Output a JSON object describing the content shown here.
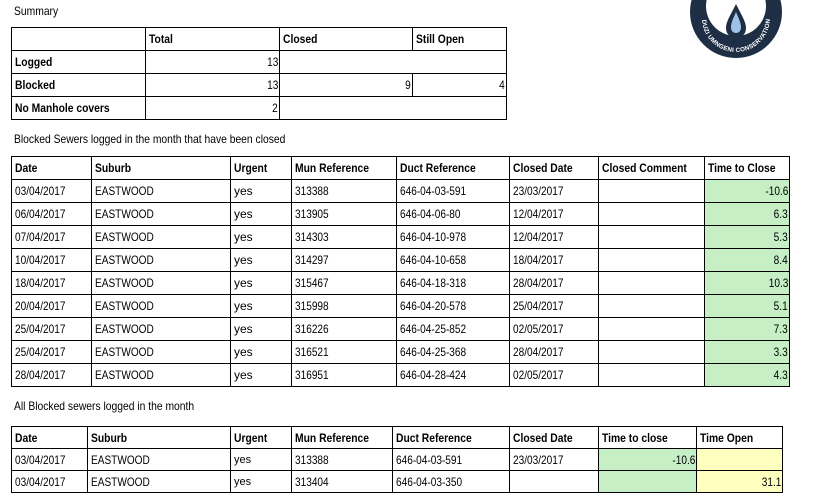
{
  "summary": {
    "title": "Summary",
    "headers": [
      "",
      "Total",
      "Closed",
      "Still Open"
    ],
    "rows": [
      {
        "label": "Logged",
        "total": "13",
        "closed": "",
        "open": ""
      },
      {
        "label": "Blocked",
        "total": "13",
        "closed": "9",
        "open": "4"
      },
      {
        "label": "No Manhole covers",
        "total": "2",
        "closed": "",
        "open": ""
      }
    ]
  },
  "closed_section": {
    "title": "Blocked Sewers logged in the month that have been closed",
    "headers": [
      "Date",
      "Suburb",
      "Urgent",
      "Mun Reference",
      "Duct Reference",
      "Closed Date",
      "Closed Comment",
      "Time to Close"
    ],
    "rows": [
      {
        "date": "03/04/2017",
        "suburb": "EASTWOOD",
        "urgent": "yes",
        "mun": "313388",
        "duct": "646-04-03-591",
        "closed_date": "23/03/2017",
        "comment": "",
        "time": "-10.6"
      },
      {
        "date": "06/04/2017",
        "suburb": "EASTWOOD",
        "urgent": "yes",
        "mun": "313905",
        "duct": "646-04-06-80",
        "closed_date": "12/04/2017",
        "comment": "",
        "time": "6.3"
      },
      {
        "date": "07/04/2017",
        "suburb": "EASTWOOD",
        "urgent": "yes",
        "mun": "314303",
        "duct": "646-04-10-978",
        "closed_date": "12/04/2017",
        "comment": "",
        "time": "5.3"
      },
      {
        "date": "10/04/2017",
        "suburb": "EASTWOOD",
        "urgent": "yes",
        "mun": "314297",
        "duct": "646-04-10-658",
        "closed_date": "18/04/2017",
        "comment": "",
        "time": "8.4"
      },
      {
        "date": "18/04/2017",
        "suburb": "EASTWOOD",
        "urgent": "yes",
        "mun": "315467",
        "duct": "646-04-18-318",
        "closed_date": "28/04/2017",
        "comment": "",
        "time": "10.3"
      },
      {
        "date": "20/04/2017",
        "suburb": "EASTWOOD",
        "urgent": "yes",
        "mun": "315998",
        "duct": "646-04-20-578",
        "closed_date": "25/04/2017",
        "comment": "",
        "time": "5.1"
      },
      {
        "date": "25/04/2017",
        "suburb": "EASTWOOD",
        "urgent": "yes",
        "mun": "316226",
        "duct": "646-04-25-852",
        "closed_date": "02/05/2017",
        "comment": "",
        "time": "7.3"
      },
      {
        "date": "25/04/2017",
        "suburb": "EASTWOOD",
        "urgent": "yes",
        "mun": "316521",
        "duct": "646-04-25-368",
        "closed_date": "28/04/2017",
        "comment": "",
        "time": "3.3"
      },
      {
        "date": "28/04/2017",
        "suburb": "EASTWOOD",
        "urgent": "yes",
        "mun": "316951",
        "duct": "646-04-28-424",
        "closed_date": "02/05/2017",
        "comment": "",
        "time": "4.3"
      }
    ]
  },
  "all_section": {
    "title": "All Blocked sewers logged in the month",
    "headers": [
      "Date",
      "Suburb",
      "Urgent",
      "Mun Reference",
      "Duct Reference",
      "Closed Date",
      "Time to close",
      "Time Open"
    ],
    "rows": [
      {
        "date": "03/04/2017",
        "suburb": "EASTWOOD",
        "urgent": "yes",
        "mun": "313388",
        "duct": "646-04-03-591",
        "closed_date": "23/03/2017",
        "time_close": "-10.6",
        "time_open": ""
      },
      {
        "date": "03/04/2017",
        "suburb": "EASTWOOD",
        "urgent": "yes",
        "mun": "313404",
        "duct": "646-04-03-350",
        "closed_date": "",
        "time_close": "",
        "time_open": "31.1"
      }
    ]
  },
  "logo": {
    "text": "DUZI UMNGENI CONSERVATION TRUST"
  },
  "colors": {
    "green": "#c6efc6",
    "yellow": "#ffffc0",
    "logo_dark": "#1e2e45"
  }
}
